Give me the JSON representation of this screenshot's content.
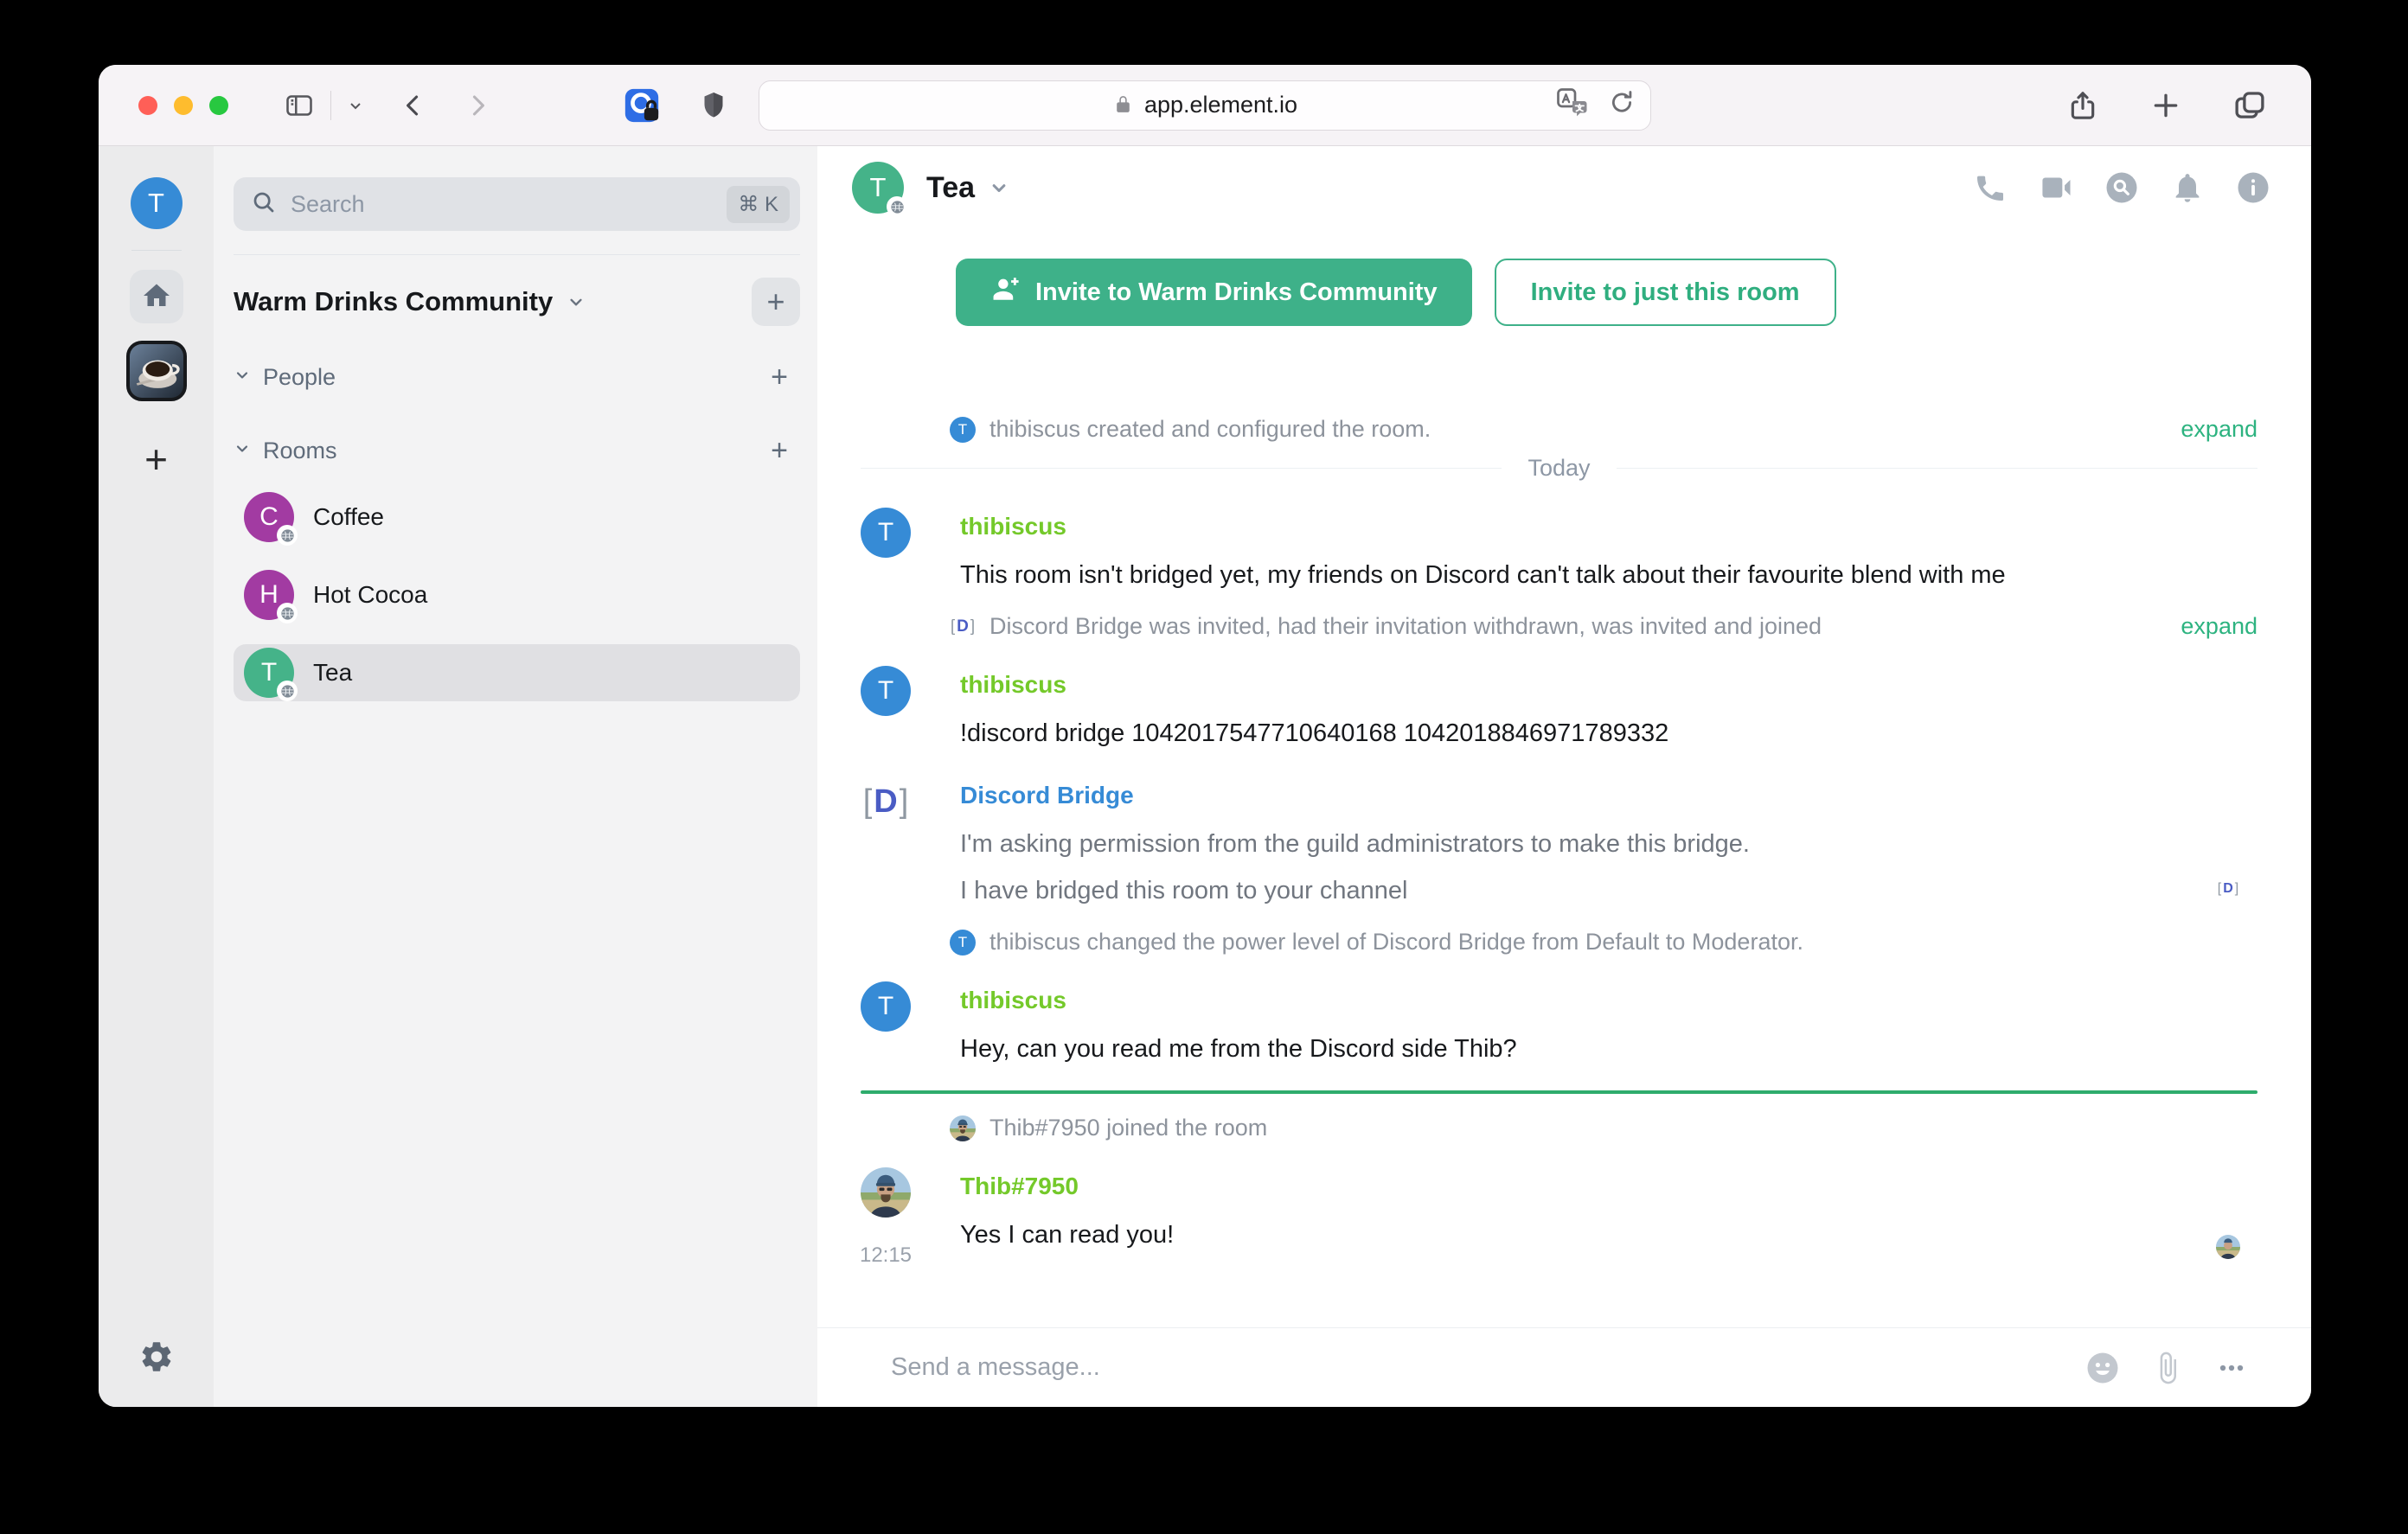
{
  "browser": {
    "url": "app.element.io",
    "window_controls": [
      "close",
      "minimize",
      "zoom"
    ]
  },
  "icons": {
    "plus": "+",
    "dots": "•••",
    "command_k_shortcut": "⌘ K"
  },
  "space_panel": {
    "user_initial": "T",
    "add_label": "+"
  },
  "room_list": {
    "search": {
      "placeholder": "Search",
      "shortcut": "⌘ K"
    },
    "space_name": "Warm Drinks Community",
    "add_label": "+",
    "sections": [
      {
        "label": "People",
        "add": "+"
      },
      {
        "label": "Rooms",
        "add": "+"
      }
    ],
    "rooms": [
      {
        "name": "Coffee",
        "initial": "C",
        "color": "#a23ba2",
        "selected": false
      },
      {
        "name": "Hot Cocoa",
        "initial": "H",
        "color": "#a23ba2",
        "selected": false
      },
      {
        "name": "Tea",
        "initial": "T",
        "color": "#45b389",
        "selected": true
      }
    ]
  },
  "chat": {
    "title": "Tea",
    "invite_primary": "Invite to Warm Drinks Community",
    "invite_secondary": "Invite to just this room",
    "bot_avatar": {
      "left": "[",
      "letter": "D",
      "right": "]"
    },
    "timeline": {
      "created_event": {
        "avatar_initial": "T",
        "text": "thibiscus created and configured the room.",
        "action": "expand"
      },
      "day_separator": "Today",
      "msg_bridge_intro": {
        "avatar_initial": "T",
        "sender": "thibiscus",
        "text": "This room isn't bridged yet, my friends on Discord can't talk about their favourite blend with me"
      },
      "invite_event": {
        "text": "Discord Bridge was invited, had their invitation withdrawn, was invited and joined",
        "action": "expand"
      },
      "msg_command": {
        "avatar_initial": "T",
        "sender": "thibiscus",
        "text": "!discord bridge 1042017547710640168 1042018846971789332"
      },
      "msg_bot": {
        "sender": "Discord Bridge",
        "lines": [
          "I'm asking permission from the guild administrators to make this bridge.",
          "I have bridged this room to your channel"
        ]
      },
      "power_event": {
        "avatar_initial": "T",
        "text": "thibiscus changed the power level of Discord Bridge from Default to Moderator."
      },
      "msg_hey": {
        "avatar_initial": "T",
        "sender": "thibiscus",
        "text": "Hey, can you read me from the Discord side Thib?"
      },
      "joined_event": {
        "text": "Thib#7950 joined the room"
      },
      "msg_reply": {
        "sender": "Thib#7950",
        "time": "12:15",
        "text": "Yes I can read you!"
      }
    },
    "composer": {
      "placeholder": "Send a message..."
    }
  },
  "colors": {
    "accent": "#0dbd8b",
    "invite_button": "#3eb189",
    "expand_link": "#2db380",
    "unread_marker": "#2eac6c",
    "name_lime": "#74c92a",
    "name_blue": "#368bd6",
    "avatar_blue": "#368bd6",
    "avatar_green": "#45b389",
    "avatar_purple": "#a23ba2"
  }
}
